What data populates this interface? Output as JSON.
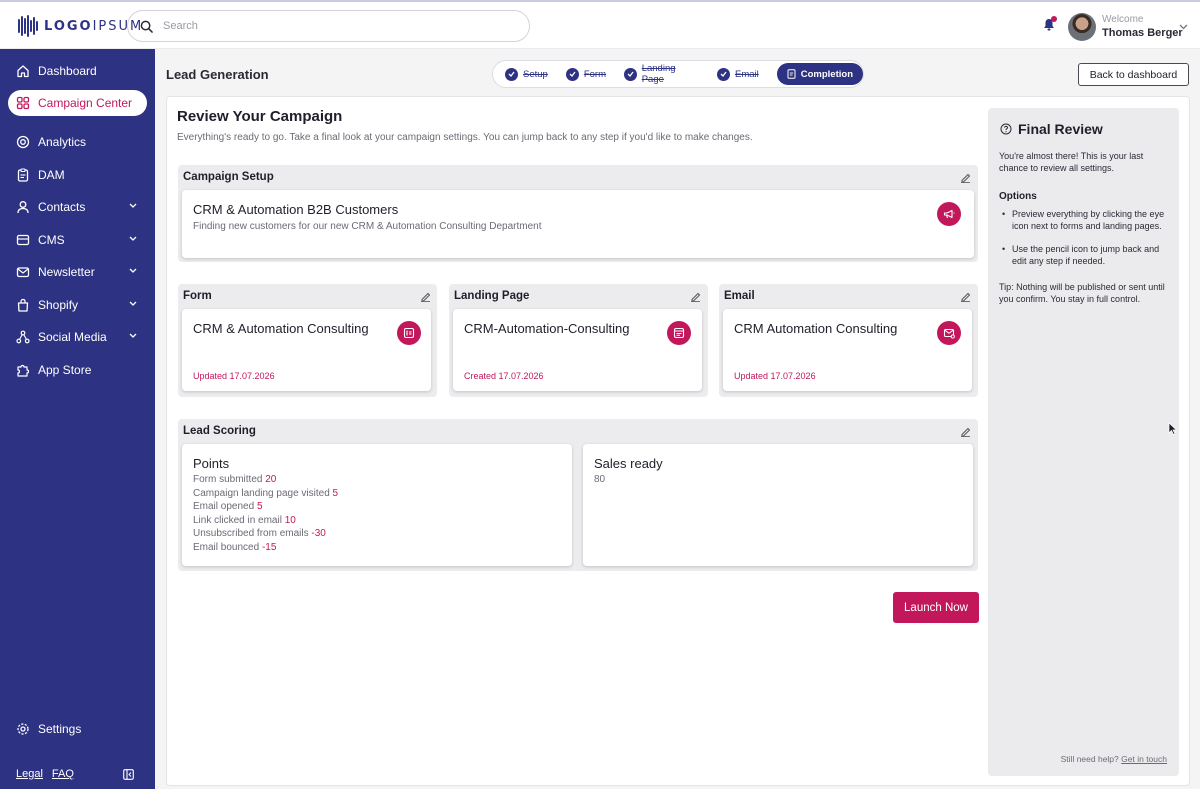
{
  "brand": {
    "logo_text_bold": "LOGO",
    "logo_text_light": "IPSUM",
    "accent": "#c2185b",
    "navy": "#2e3282"
  },
  "search": {
    "placeholder": "Search"
  },
  "user": {
    "welcome": "Welcome",
    "name": "Thomas Berger"
  },
  "sidebar": {
    "items": [
      {
        "label": "Dashboard",
        "icon": "home-icon"
      },
      {
        "label": "Campaign Center",
        "icon": "grid-icon",
        "active": true
      },
      {
        "label": "Analytics",
        "icon": "analytics-icon"
      },
      {
        "label": "DAM",
        "icon": "clipboard-icon"
      },
      {
        "label": "Contacts",
        "icon": "user-icon",
        "expandable": true
      },
      {
        "label": "CMS",
        "icon": "cms-icon",
        "expandable": true
      },
      {
        "label": "Newsletter",
        "icon": "mail-icon",
        "expandable": true
      },
      {
        "label": "Shopify",
        "icon": "bag-icon",
        "expandable": true
      },
      {
        "label": "Social Media",
        "icon": "share-icon",
        "expandable": true
      },
      {
        "label": "App Store",
        "icon": "puzzle-icon"
      }
    ],
    "settings": "Settings",
    "legal": "Legal",
    "faq": "FAQ"
  },
  "header": {
    "title": "Lead Generation",
    "steps": [
      "Setup",
      "Form",
      "Landing Page",
      "Email",
      "Completion"
    ],
    "back_button": "Back to dashboard"
  },
  "review": {
    "title": "Review Your Campaign",
    "subtitle": "Everything's ready to go. Take a final look at your campaign settings. You can jump back to any step if you'd like to make changes.",
    "setup": {
      "label": "Campaign Setup",
      "title": "CRM & Automation B2B Customers",
      "description": "Finding new customers for our new CRM & Automation Consulting Department"
    },
    "form": {
      "label": "Form",
      "title": "CRM & Automation Consulting",
      "date": "Updated 17.07.2026"
    },
    "landing": {
      "label": "Landing Page",
      "title": "CRM-Automation-Consulting",
      "date": "Created 17.07.2026"
    },
    "email": {
      "label": "Email",
      "title": "CRM Automation Consulting",
      "date": "Updated 17.07.2026"
    },
    "scoring": {
      "label": "Lead Scoring",
      "points_title": "Points",
      "points": [
        {
          "label": "Form submitted",
          "value": "20"
        },
        {
          "label": "Campaign landing page visited",
          "value": "5"
        },
        {
          "label": "Email opened",
          "value": "5"
        },
        {
          "label": "Link clicked in email",
          "value": "10"
        },
        {
          "label": "Unsubscribed from emails",
          "value": "-30"
        },
        {
          "label": "Email bounced",
          "value": "-15"
        }
      ],
      "sales_title": "Sales ready",
      "sales_value": "80"
    },
    "launch_button": "Launch Now"
  },
  "final_review": {
    "title": "Final Review",
    "intro": "You're almost there! This is your last chance to review all settings.",
    "options_title": "Options",
    "options": [
      "Preview everything by clicking the eye icon next to forms and landing pages.",
      "Use the pencil icon to jump back and edit any step if needed."
    ],
    "tip": "Tip: Nothing will be published or sent until you confirm. You stay in full control.",
    "help_text": "Still need help?",
    "help_link": "Get in touch"
  }
}
